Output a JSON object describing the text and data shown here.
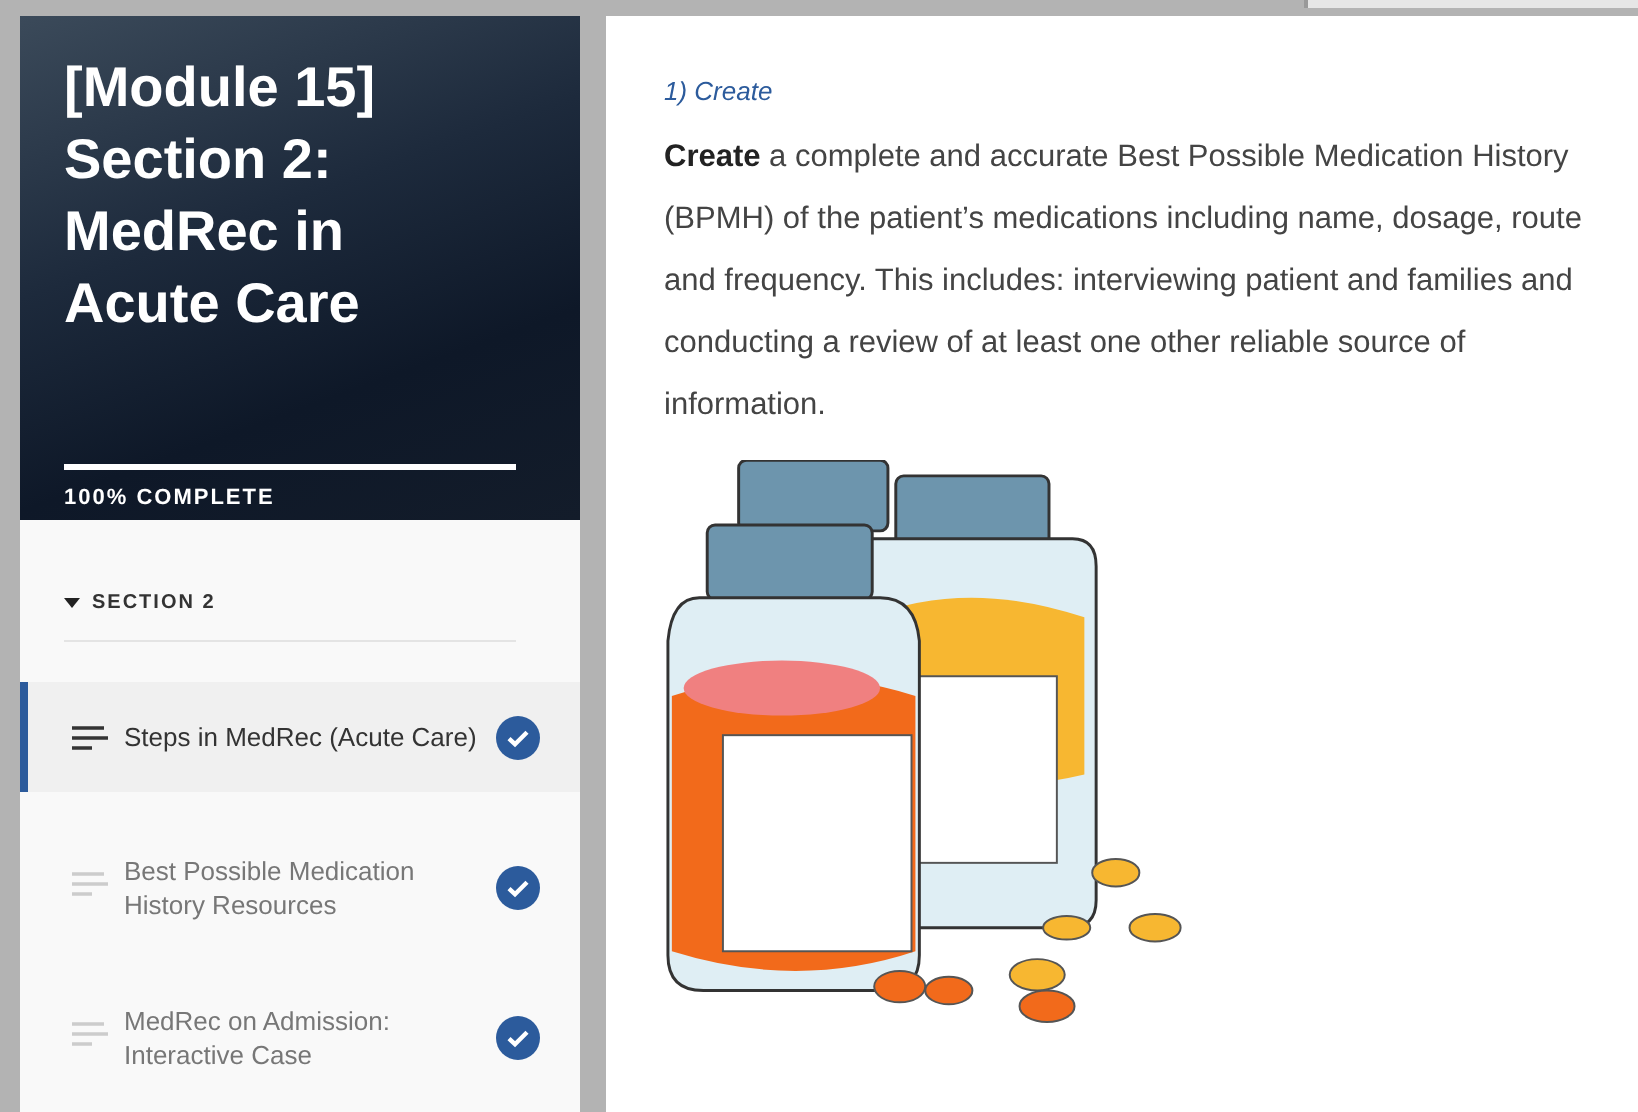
{
  "sidebar": {
    "title": "[Module 15] Section 2: MedRec in Acute Care",
    "progress": {
      "level": 1,
      "label": "100% COMPLETE"
    },
    "section": {
      "label": "SECTION 2",
      "expanded": true
    },
    "lessons": [
      {
        "label": "Steps in MedRec (Acute Care)",
        "selected": true,
        "completed": true
      },
      {
        "label": "Best Possible Medication History Resources",
        "selected": false,
        "completed": true
      },
      {
        "label": "MedRec on Admission: Interactive Case",
        "selected": false,
        "completed": true
      }
    ]
  },
  "content": {
    "heading": "1) Create",
    "paragraph": "**Create** a complete and accurate Best Possible Medication History (BPMH) of the patient’s medications including name, dosage, route and frequency. This includes: interviewing patient and families and conducting a review of at least one other reliable source of information."
  }
}
